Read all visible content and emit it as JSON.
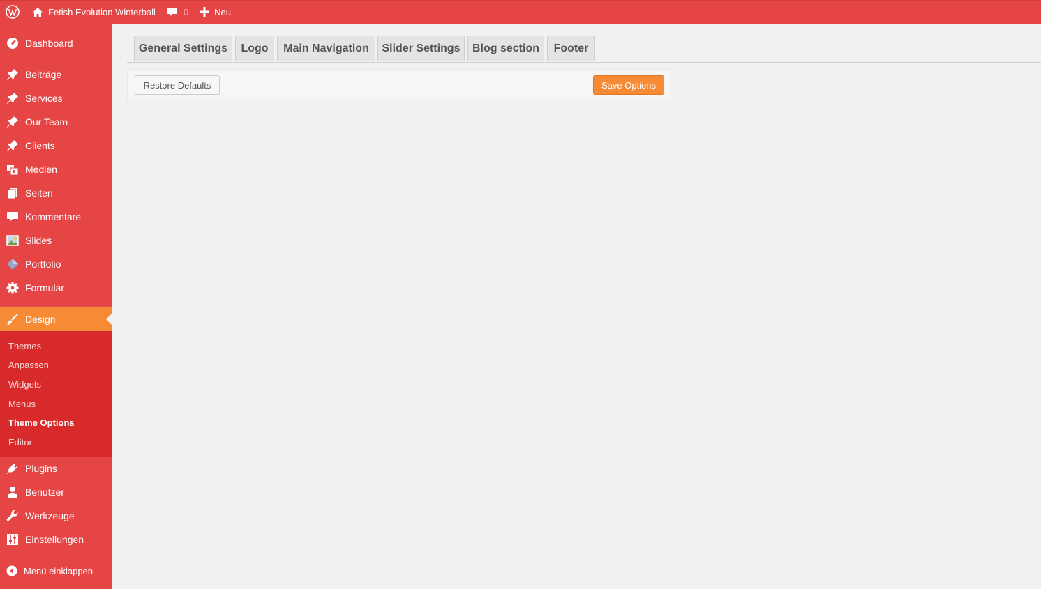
{
  "adminbar": {
    "site_name": "Fetish Evolution Winterball",
    "comments_count": "0",
    "new_label": "Neu"
  },
  "sidebar": {
    "items": [
      {
        "label": "Dashboard",
        "icon": "dashboard-icon"
      },
      {
        "label": "Beiträge",
        "icon": "pin-icon"
      },
      {
        "label": "Services",
        "icon": "pin-icon"
      },
      {
        "label": "Our Team",
        "icon": "pin-icon"
      },
      {
        "label": "Clients",
        "icon": "pin-icon"
      },
      {
        "label": "Medien",
        "icon": "media-icon"
      },
      {
        "label": "Seiten",
        "icon": "pages-icon"
      },
      {
        "label": "Kommentare",
        "icon": "comment-icon"
      },
      {
        "label": "Slides",
        "icon": "slides-icon"
      },
      {
        "label": "Portfolio",
        "icon": "portfolio-icon"
      },
      {
        "label": "Formular",
        "icon": "gear-icon"
      },
      {
        "label": "Design",
        "icon": "brush-icon"
      },
      {
        "label": "Plugins",
        "icon": "plugin-icon"
      },
      {
        "label": "Benutzer",
        "icon": "user-icon"
      },
      {
        "label": "Werkzeuge",
        "icon": "wrench-icon"
      },
      {
        "label": "Einstellungen",
        "icon": "settings-icon"
      }
    ],
    "submenu": [
      "Themes",
      "Anpassen",
      "Widgets",
      "Menüs",
      "Theme Options",
      "Editor"
    ],
    "collapse_label": "Menü einklappen"
  },
  "tabs": [
    "General Settings",
    "Logo",
    "Main Navigation",
    "Slider Settings",
    "Blog section",
    "Footer"
  ],
  "toolbar": {
    "restore_label": "Restore Defaults",
    "save_label": "Save Options"
  },
  "colors": {
    "accent": "#e64546",
    "active": "#f78a34",
    "submenu_bg": "#d8292b"
  }
}
